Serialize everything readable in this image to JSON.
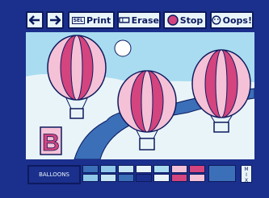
{
  "toolbar": {
    "print_label": "Print",
    "erase_label": "Erase",
    "stop_label": "Stop",
    "oops_label": "Oops!",
    "sel_label": "SEL"
  },
  "palette": {
    "name_label": "BALLOONS",
    "mix_label": "M\nI\nX",
    "colors": [
      "#3b6fb8",
      "#8fc8e8",
      "#c7e6f5",
      "#e8f4f8",
      "#f5c1d6",
      "#d4447e",
      "#f5c1d6",
      "#1b2f8c",
      "#3b6fb8"
    ]
  },
  "canvas": {
    "letter": "B",
    "colors": {
      "sky": "#a9dcf0",
      "ground": "#e8f4f8",
      "river": "#3b6fb8",
      "pink": "#d4447e",
      "light_pink": "#f5c1d6",
      "white": "#ffffff",
      "outline": "#0d1a5e"
    }
  }
}
